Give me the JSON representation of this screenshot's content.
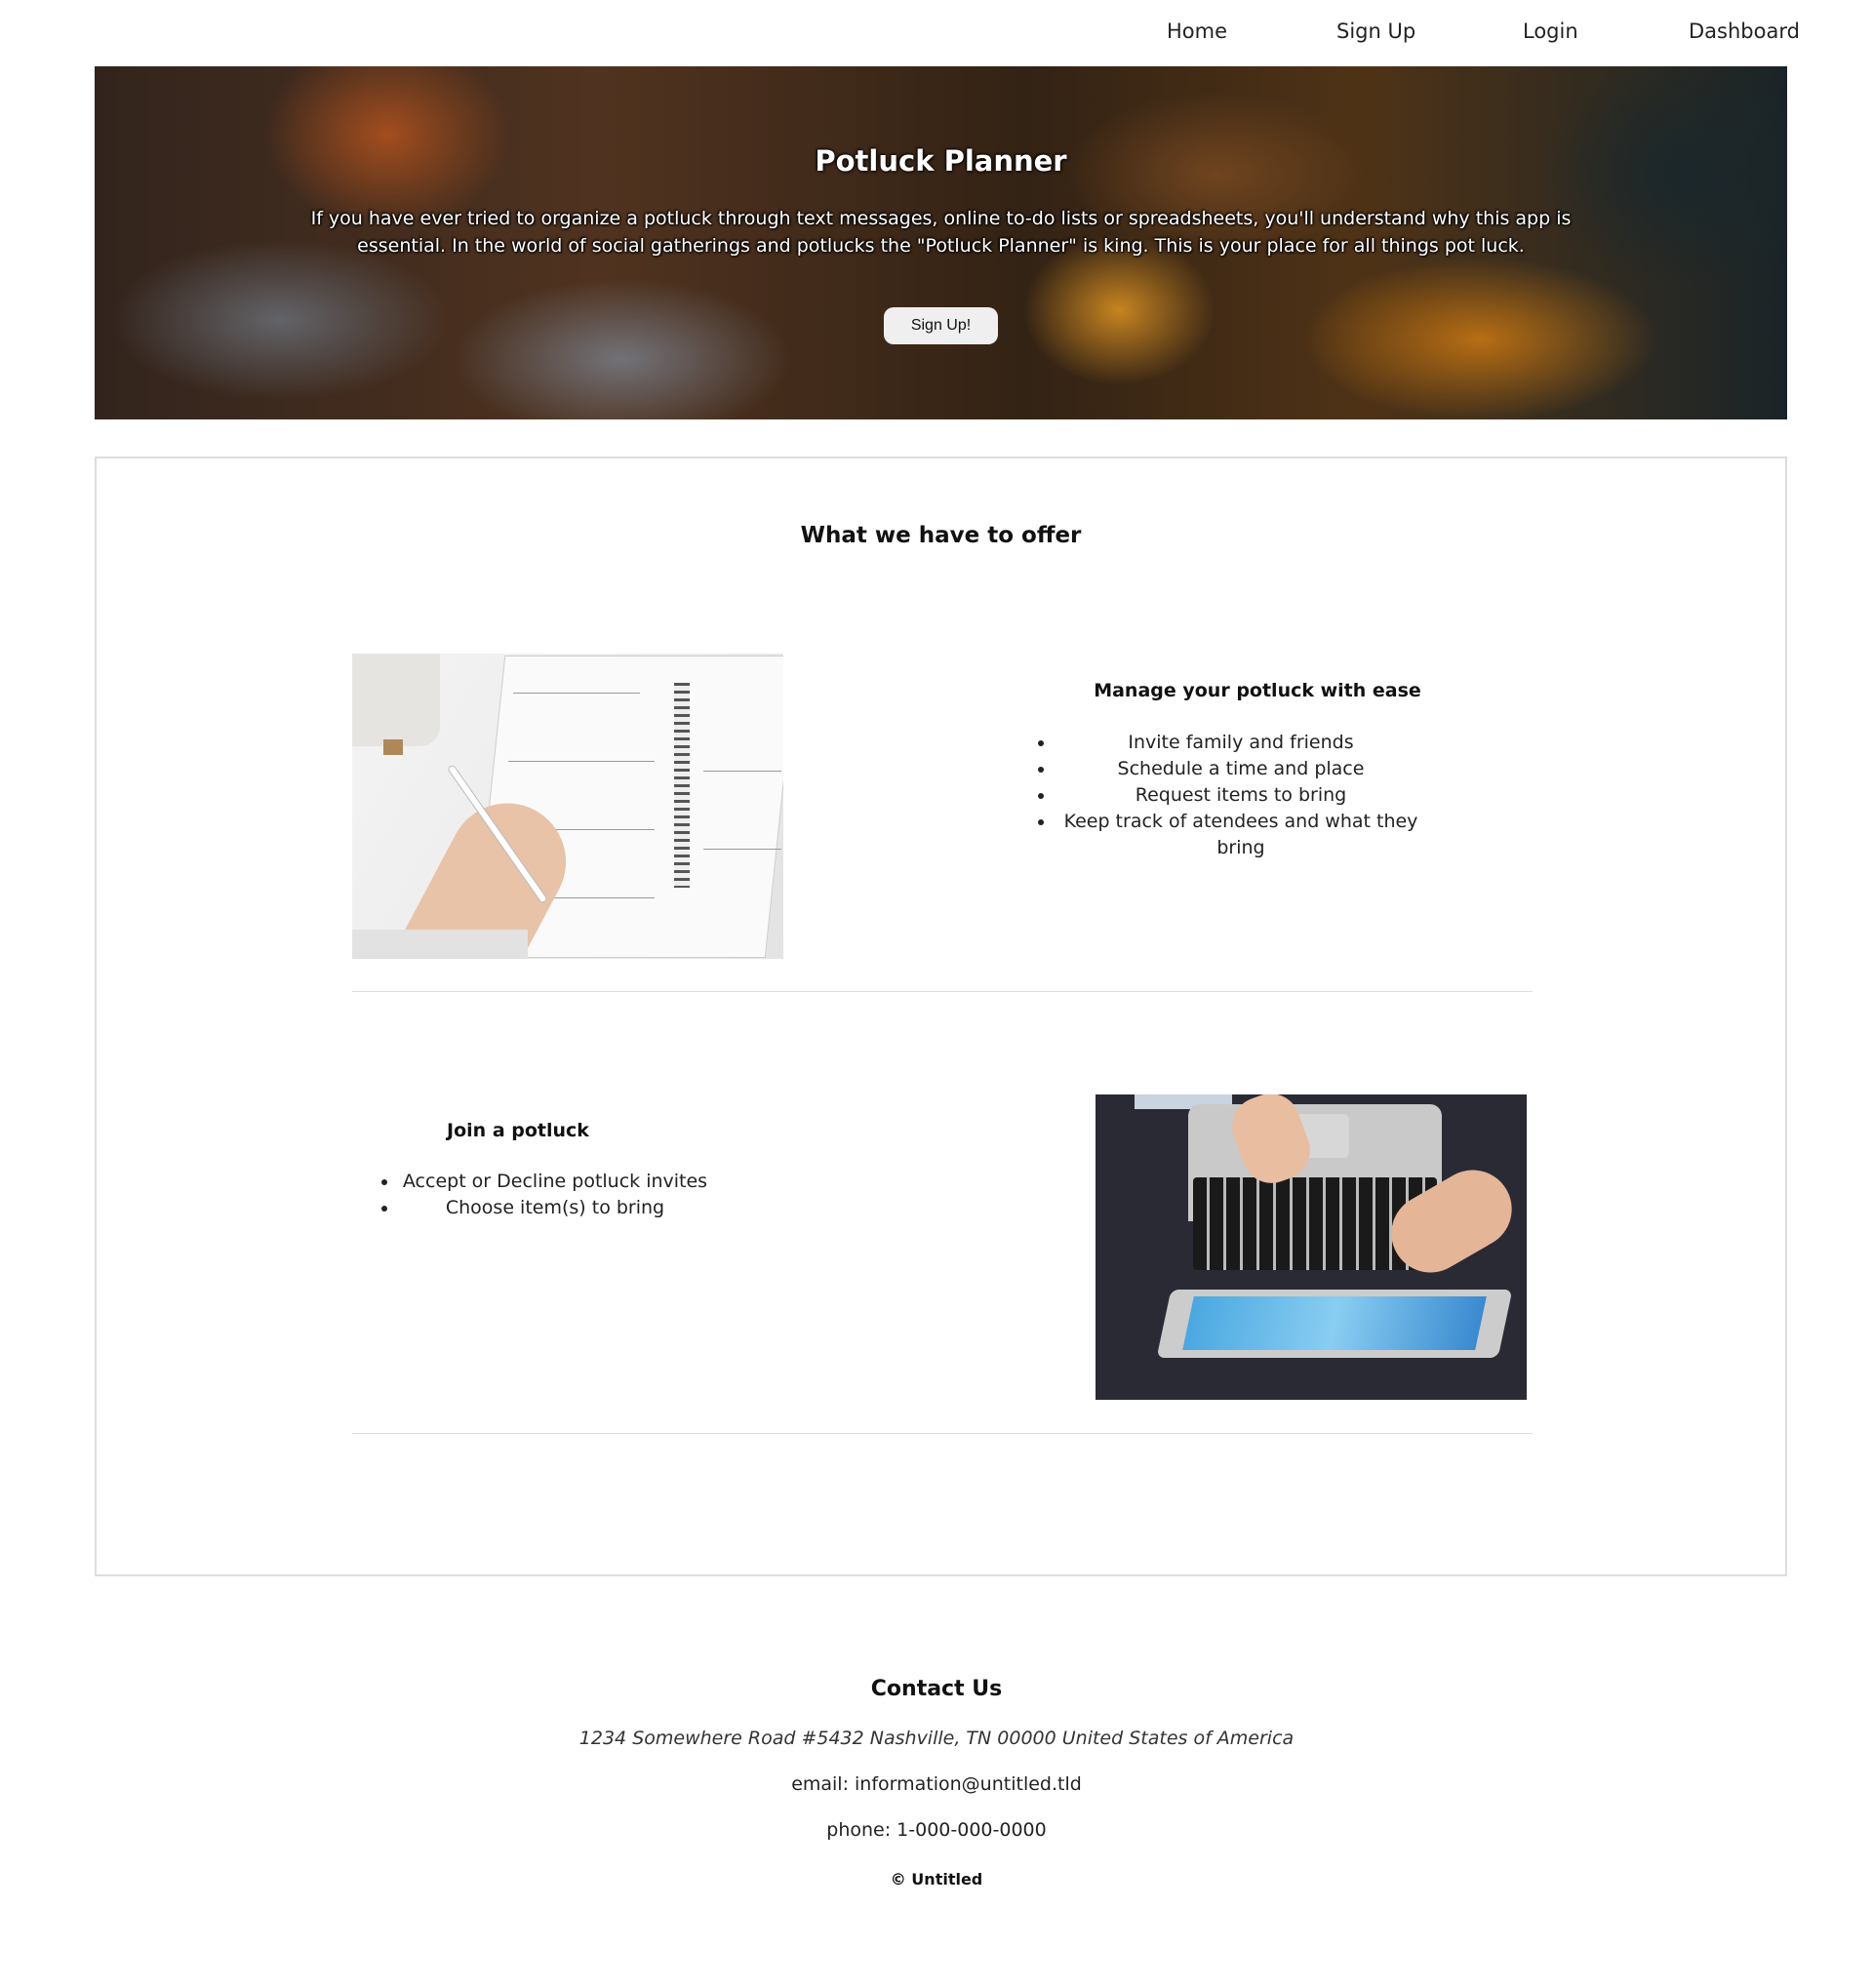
{
  "nav": {
    "items": [
      {
        "label": "Home"
      },
      {
        "label": "Sign Up"
      },
      {
        "label": "Login"
      },
      {
        "label": "Dashboard"
      }
    ]
  },
  "hero": {
    "title": "Potluck Planner",
    "text": "If you have ever tried to organize a potluck through text messages, online to-do lists or spreadsheets, you'll understand why this app is essential. In the world of social gatherings and potlucks the \"Potluck Planner\" is king. This is your place for all things pot luck.",
    "button_label": "Sign Up!"
  },
  "offer": {
    "title": "What we have to offer",
    "section1": {
      "heading": "Manage your potluck with ease",
      "items": [
        "Invite family and friends",
        "Schedule a time and place",
        "Request items to bring",
        "Keep track of atendees and what they bring"
      ]
    },
    "section2": {
      "heading": "Join a potluck",
      "items": [
        "Accept or Decline potluck invites",
        "Choose item(s) to bring"
      ]
    }
  },
  "contact": {
    "title": "Contact Us",
    "address": "1234 Somewhere Road #5432 Nashville, TN 00000 United States of America",
    "email": "email: information@untitled.tld",
    "phone": "phone: 1-000-000-0000"
  },
  "footer": {
    "copyright": "© Untitled"
  }
}
